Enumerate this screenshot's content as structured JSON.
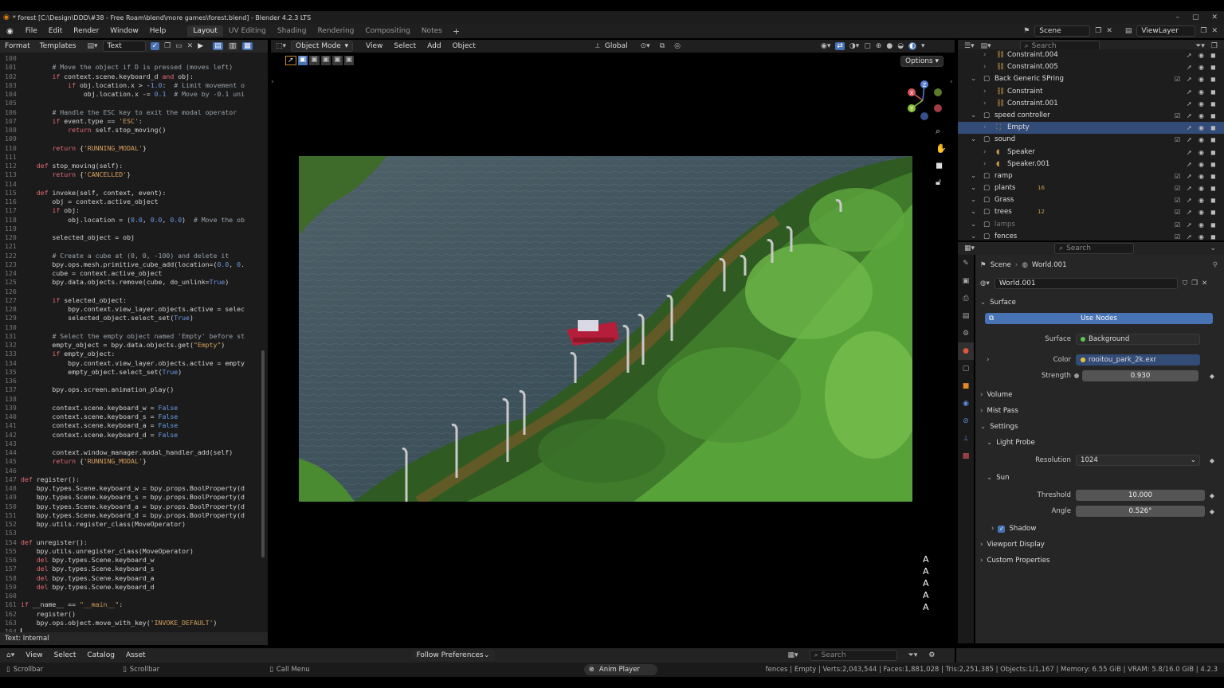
{
  "window": {
    "title": "* forest [C:\\Design\\DDD\\#38 - Free Roam\\blend\\more games\\forest.blend] - Blender 4.2.3 LTS",
    "minimize": "–",
    "maximize": "▢",
    "close": "✕"
  },
  "menu": [
    "File",
    "Edit",
    "Render",
    "Window",
    "Help"
  ],
  "workspaces": [
    {
      "label": "Layout",
      "active": true
    },
    {
      "label": "UV Editing",
      "active": false
    },
    {
      "label": "Shading",
      "active": false
    },
    {
      "label": "Rendering",
      "active": false
    },
    {
      "label": "Compositing",
      "active": false
    },
    {
      "label": "Notes",
      "active": false
    }
  ],
  "add_workspace": "+",
  "scene_field": "Scene",
  "viewlayer_field": "ViewLayer",
  "text_editor": {
    "format": "Format",
    "templates": "Templates",
    "text_name": "Text",
    "status": "Text: Internal",
    "lines": [
      {
        "n": "100",
        "t": ""
      },
      {
        "n": "101",
        "t": "        # Move the object if D is pressed (moves left)"
      },
      {
        "n": "102",
        "t": "        if context.scene.keyboard_d and obj:"
      },
      {
        "n": "103",
        "t": "            if obj.location.x > -1.0:  # Limit movement o"
      },
      {
        "n": "104",
        "t": "                obj.location.x -= 0.1  # Move by -0.1 uni"
      },
      {
        "n": "105",
        "t": ""
      },
      {
        "n": "106",
        "t": "        # Handle the ESC key to exit the modal operator"
      },
      {
        "n": "107",
        "t": "        if event.type == 'ESC':"
      },
      {
        "n": "108",
        "t": "            return self.stop_moving()"
      },
      {
        "n": "109",
        "t": ""
      },
      {
        "n": "110",
        "t": "        return {'RUNNING_MODAL'}"
      },
      {
        "n": "111",
        "t": ""
      },
      {
        "n": "112",
        "t": "    def stop_moving(self):"
      },
      {
        "n": "113",
        "t": "        return {'CANCELLED'}"
      },
      {
        "n": "114",
        "t": ""
      },
      {
        "n": "115",
        "t": "    def invoke(self, context, event):"
      },
      {
        "n": "116",
        "t": "        obj = context.active_object"
      },
      {
        "n": "117",
        "t": "        if obj:"
      },
      {
        "n": "118",
        "t": "            obj.location = (0.0, 0.0, 0.0)  # Move the ob"
      },
      {
        "n": "119",
        "t": ""
      },
      {
        "n": "120",
        "t": "        selected_object = obj"
      },
      {
        "n": "121",
        "t": ""
      },
      {
        "n": "122",
        "t": "        # Create a cube at (0, 0, -100) and delete it"
      },
      {
        "n": "123",
        "t": "        bpy.ops.mesh.primitive_cube_add(location=(0.0, 0."
      },
      {
        "n": "124",
        "t": "        cube = context.active_object"
      },
      {
        "n": "125",
        "t": "        bpy.data.objects.remove(cube, do_unlink=True)"
      },
      {
        "n": "126",
        "t": ""
      },
      {
        "n": "127",
        "t": "        if selected_object:"
      },
      {
        "n": "128",
        "t": "            bpy.context.view_layer.objects.active = selec"
      },
      {
        "n": "129",
        "t": "            selected_object.select_set(True)"
      },
      {
        "n": "130",
        "t": ""
      },
      {
        "n": "131",
        "t": "        # Select the empty object named 'Empty' before st"
      },
      {
        "n": "132",
        "t": "        empty_object = bpy.data.objects.get(\"Empty\")"
      },
      {
        "n": "133",
        "t": "        if empty_object:"
      },
      {
        "n": "134",
        "t": "            bpy.context.view_layer.objects.active = empty"
      },
      {
        "n": "135",
        "t": "            empty_object.select_set(True)"
      },
      {
        "n": "136",
        "t": ""
      },
      {
        "n": "137",
        "t": "        bpy.ops.screen.animation_play()"
      },
      {
        "n": "138",
        "t": ""
      },
      {
        "n": "139",
        "t": "        context.scene.keyboard_w = False"
      },
      {
        "n": "140",
        "t": "        context.scene.keyboard_s = False"
      },
      {
        "n": "141",
        "t": "        context.scene.keyboard_a = False"
      },
      {
        "n": "142",
        "t": "        context.scene.keyboard_d = False"
      },
      {
        "n": "143",
        "t": ""
      },
      {
        "n": "144",
        "t": "        context.window_manager.modal_handler_add(self)"
      },
      {
        "n": "145",
        "t": "        return {'RUNNING_MODAL'}"
      },
      {
        "n": "146",
        "t": ""
      },
      {
        "n": "147",
        "t": "def register():"
      },
      {
        "n": "148",
        "t": "    bpy.types.Scene.keyboard_w = bpy.props.BoolProperty(d"
      },
      {
        "n": "149",
        "t": "    bpy.types.Scene.keyboard_s = bpy.props.BoolProperty(d"
      },
      {
        "n": "150",
        "t": "    bpy.types.Scene.keyboard_a = bpy.props.BoolProperty(d"
      },
      {
        "n": "151",
        "t": "    bpy.types.Scene.keyboard_d = bpy.props.BoolProperty(d"
      },
      {
        "n": "152",
        "t": "    bpy.utils.register_class(MoveOperator)"
      },
      {
        "n": "153",
        "t": ""
      },
      {
        "n": "154",
        "t": "def unregister():"
      },
      {
        "n": "155",
        "t": "    bpy.utils.unregister_class(MoveOperator)"
      },
      {
        "n": "156",
        "t": "    del bpy.types.Scene.keyboard_w"
      },
      {
        "n": "157",
        "t": "    del bpy.types.Scene.keyboard_s"
      },
      {
        "n": "158",
        "t": "    del bpy.types.Scene.keyboard_a"
      },
      {
        "n": "159",
        "t": "    del bpy.types.Scene.keyboard_d"
      },
      {
        "n": "160",
        "t": ""
      },
      {
        "n": "161",
        "t": "if __name__ == \"__main__\":"
      },
      {
        "n": "162",
        "t": "    register()"
      },
      {
        "n": "163",
        "t": "    bpy.ops.object.move_with_key('INVOKE_DEFAULT')"
      },
      {
        "n": "164",
        "t": ""
      }
    ]
  },
  "viewport": {
    "mode": "Object Mode",
    "menus": [
      "View",
      "Select",
      "Add",
      "Object"
    ],
    "orientation": "Global",
    "options": "Options",
    "overlay_letters": [
      "A",
      "A",
      "A",
      "A",
      "A"
    ],
    "gizmo_axes": {
      "z": "Z",
      "x": "X",
      "y": "Y"
    }
  },
  "outliner": {
    "search_placeholder": "Search",
    "rows": [
      {
        "label": "Constraint.004",
        "depth": 2,
        "sel": false,
        "icon": "constraint",
        "dim": false
      },
      {
        "label": "Constraint.005",
        "depth": 2,
        "sel": false,
        "icon": "constraint",
        "dim": false
      },
      {
        "label": "Back Generic SPring",
        "depth": 1,
        "sel": false,
        "icon": "collection",
        "dim": false
      },
      {
        "label": "Constraint",
        "depth": 2,
        "sel": false,
        "icon": "constraint",
        "dim": false
      },
      {
        "label": "Constraint.001",
        "depth": 2,
        "sel": false,
        "icon": "constraint",
        "dim": false
      },
      {
        "label": "speed controller",
        "depth": 1,
        "sel": false,
        "icon": "collection",
        "dim": false
      },
      {
        "label": "Empty",
        "depth": 2,
        "sel": true,
        "icon": "empty",
        "dim": false
      },
      {
        "label": "sound",
        "depth": 1,
        "sel": false,
        "icon": "collection",
        "dim": false
      },
      {
        "label": "Speaker",
        "depth": 2,
        "sel": false,
        "icon": "speaker",
        "dim": false
      },
      {
        "label": "Speaker.001",
        "depth": 2,
        "sel": false,
        "icon": "speaker",
        "dim": false
      },
      {
        "label": "ramp",
        "depth": 1,
        "sel": false,
        "icon": "collection",
        "dim": false
      },
      {
        "label": "plants",
        "depth": 1,
        "sel": false,
        "icon": "collection",
        "dim": false,
        "badge": "16"
      },
      {
        "label": "Grass",
        "depth": 1,
        "sel": false,
        "icon": "collection",
        "dim": false
      },
      {
        "label": "trees",
        "depth": 1,
        "sel": false,
        "icon": "collection",
        "dim": false,
        "badge": "12"
      },
      {
        "label": "lamps",
        "depth": 1,
        "sel": false,
        "icon": "collection",
        "dim": true
      },
      {
        "label": "fences",
        "depth": 1,
        "sel": false,
        "icon": "collection",
        "dim": false
      }
    ]
  },
  "properties": {
    "search_placeholder": "Search",
    "breadcrumb_scene": "Scene",
    "breadcrumb_world": "World.001",
    "world_name": "World.001",
    "sections": {
      "surface": "Surface",
      "use_nodes": "Use Nodes",
      "surface_label": "Surface",
      "surface_value": "Background",
      "color_label": "Color",
      "color_value": "rooitou_park_2k.exr",
      "strength_label": "Strength",
      "strength_value": "0.930",
      "volume": "Volume",
      "mist_pass": "Mist Pass",
      "settings": "Settings",
      "light_probe": "Light Probe",
      "resolution_label": "Resolution",
      "resolution_value": "1024",
      "sun": "Sun",
      "threshold_label": "Threshold",
      "threshold_value": "10.000",
      "angle_label": "Angle",
      "angle_value": "0.526°",
      "shadow": "Shadow",
      "viewport_display": "Viewport Display",
      "custom_properties": "Custom Properties"
    }
  },
  "asset_bar": {
    "menus": [
      "View",
      "Select",
      "Catalog",
      "Asset"
    ],
    "follow": "Follow Preferences",
    "search_placeholder": "Search"
  },
  "status_bar": {
    "left1": "Scrollbar",
    "left2": "Scrollbar",
    "left3": "Call Menu",
    "anim_player": "Anim Player",
    "stats": "fences | Empty | Verts:2,043,544 | Faces:1,881,028 | Tris:2,251,385 | Objects:1/1,167 | Memory: 6.55 GiB | VRAM: 5.8/16.0 GiB | 4.2.3"
  },
  "colors": {
    "accent_blue": "#4772b3",
    "selected_row": "#334b77",
    "keyword_red": "#e06c75",
    "string_orange": "#d6a15d",
    "bool_blue": "#6a9be8"
  }
}
